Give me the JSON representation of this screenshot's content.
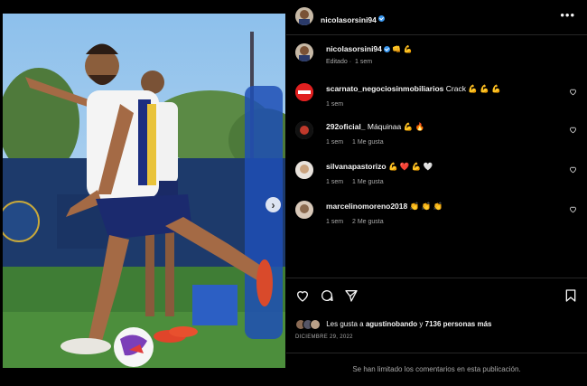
{
  "post": {
    "author": "nicolasorsini94",
    "caption_emojis": "👊 💪",
    "edited": "Editado",
    "time": "1 sem"
  },
  "comments": [
    {
      "user": "scarnato_negociosinmobiliarios",
      "text": "Crack 💪 💪 💪",
      "time": "1 sem",
      "likes": ""
    },
    {
      "user": "292oficial_",
      "text": "Máquinaa 💪 🔥",
      "time": "1 sem",
      "likes": "1 Me gusta"
    },
    {
      "user": "silvanapastorizo",
      "text": "💪 ❤️ 💪 🤍",
      "time": "1 sem",
      "likes": "1 Me gusta"
    },
    {
      "user": "marcelinomoreno2018",
      "text": "👏 👏 👏",
      "time": "1 sem",
      "likes": "2 Me gusta"
    }
  ],
  "likes": {
    "prefix": "Les gusta a",
    "user": "agustinobando",
    "suffix": "y",
    "count": "7136 personas más"
  },
  "date": "DICIEMBRE 29, 2022",
  "limited_notice": "Se han limitado los comentarios en esta publicación.",
  "colors": {
    "verified": "#3897f0",
    "border": "#262626",
    "muted": "#a8a8a8"
  }
}
